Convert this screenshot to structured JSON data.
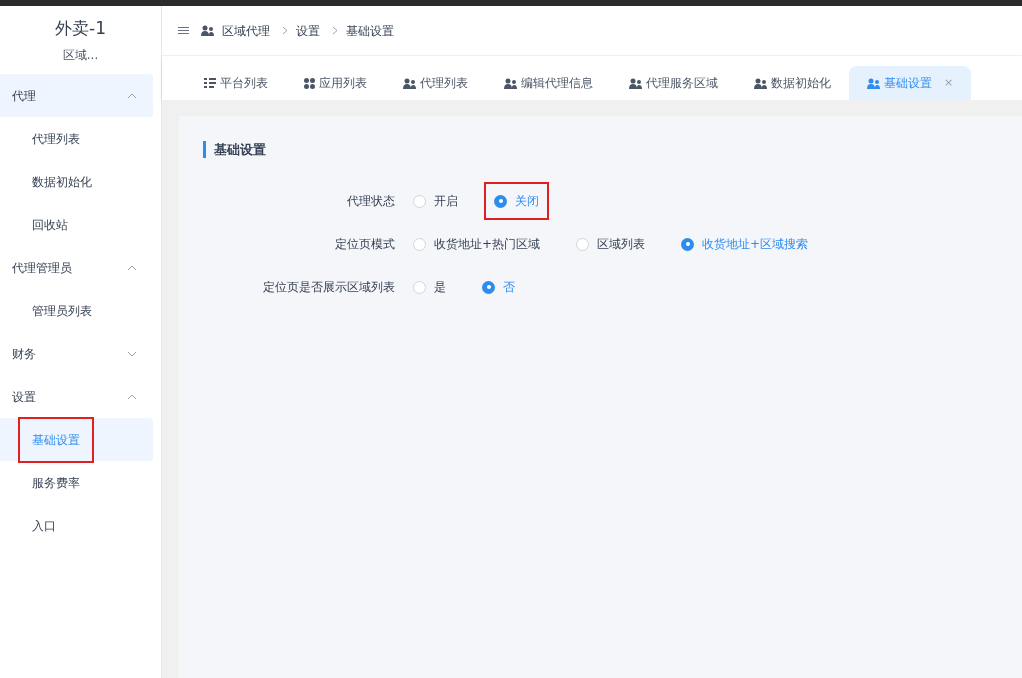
{
  "app": {
    "title": "外卖-1",
    "subtitle": "区域..."
  },
  "sidebar": {
    "groups": [
      {
        "label": "代理",
        "expanded": true,
        "selected": true,
        "children": [
          {
            "label": "代理列表",
            "selected": false,
            "highlighted": false
          },
          {
            "label": "数据初始化",
            "selected": false,
            "highlighted": false
          },
          {
            "label": "回收站",
            "selected": false,
            "highlighted": false
          }
        ]
      },
      {
        "label": "代理管理员",
        "expanded": true,
        "selected": false,
        "children": [
          {
            "label": "管理员列表",
            "selected": false,
            "highlighted": false
          }
        ]
      },
      {
        "label": "财务",
        "expanded": false,
        "selected": false
      },
      {
        "label": "设置",
        "expanded": true,
        "selected": false,
        "children": [
          {
            "label": "基础设置",
            "selected": true,
            "highlighted": true
          },
          {
            "label": "服务费率",
            "selected": false,
            "highlighted": false
          },
          {
            "label": "入口",
            "selected": false,
            "highlighted": false
          }
        ]
      }
    ]
  },
  "breadcrumb": [
    {
      "label": "区域代理",
      "kind": "icon"
    },
    {
      "label": "设置",
      "kind": "plain"
    },
    {
      "label": "基础设置",
      "kind": "plain"
    }
  ],
  "tabs": [
    {
      "label": "平台列表",
      "kind": "list",
      "selected": false
    },
    {
      "label": "应用列表",
      "kind": "apps",
      "selected": false
    },
    {
      "label": "代理列表",
      "kind": "users",
      "selected": false
    },
    {
      "label": "编辑代理信息",
      "kind": "users",
      "selected": false
    },
    {
      "label": "代理服务区域",
      "kind": "users",
      "selected": false
    },
    {
      "label": "数据初始化",
      "kind": "users",
      "selected": false
    },
    {
      "label": "基础设置",
      "kind": "users",
      "selected": true,
      "close": "×"
    }
  ],
  "panel": {
    "title": "基础设置",
    "fields": [
      {
        "label": "代理状态",
        "options": [
          {
            "label": "开启",
            "selected": false,
            "highlighted": false
          },
          {
            "label": "关闭",
            "selected": true,
            "highlighted": true
          }
        ]
      },
      {
        "label": "定位页模式",
        "options": [
          {
            "label": "收货地址+热门区域",
            "selected": false,
            "highlighted": false
          },
          {
            "label": "区域列表",
            "selected": false,
            "highlighted": false
          },
          {
            "label": "收货地址+区域搜索",
            "selected": true,
            "highlighted": false
          }
        ]
      },
      {
        "label": "定位页是否展示区域列表",
        "options": [
          {
            "label": "是",
            "selected": false,
            "highlighted": false
          },
          {
            "label": "否",
            "selected": true,
            "highlighted": false
          }
        ]
      }
    ]
  }
}
